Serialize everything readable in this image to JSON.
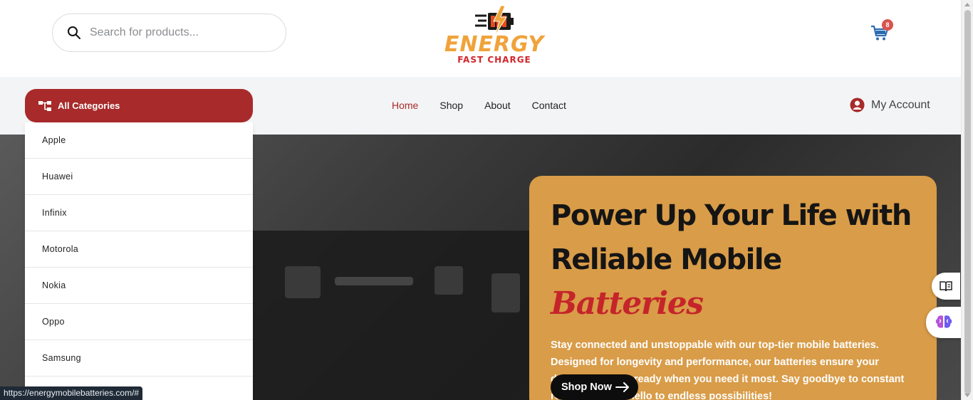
{
  "header": {
    "search_placeholder": "Search for products...",
    "logo_word": "ENERGY",
    "logo_sub": "FAST CHARGE",
    "cart_count": "8"
  },
  "nav": {
    "all_categories": "All Categories",
    "menu": [
      "Home",
      "Shop",
      "About",
      "Contact"
    ],
    "active": "Home",
    "account": "My Account"
  },
  "categories": [
    "Apple",
    "Huawei",
    "Infinix",
    "Motorola",
    "Nokia",
    "Oppo",
    "Samsung"
  ],
  "hero": {
    "title_line1": "Power Up Your Life with",
    "title_line2": "Reliable Mobile",
    "title_accent": "Batteries",
    "description": "Stay connected and unstoppable with our top-tier mobile batteries. Designed for longevity and performance, our batteries ensure your device is always ready when you need it most. Say goodbye to constant recharging and hello to endless possibilities!",
    "button": "Shop Now"
  },
  "floating": {
    "book_icon": "book-icon",
    "brain_icon": "brain-icon"
  },
  "status_url": "https://energymobilebatteries.com/#",
  "colors": {
    "brand_red": "#a82a2a",
    "hero_card": "#d99c48",
    "accent_red": "#c5252a",
    "logo_orange": "#f0a33a"
  }
}
